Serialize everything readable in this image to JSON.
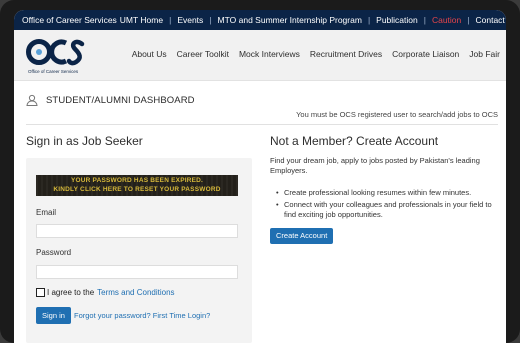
{
  "topbar": {
    "org": "Office of Career Services",
    "links": [
      "UMT Home",
      "Events",
      "MTO and Summer Internship Program",
      "Publication",
      "Caution",
      "Contact Us"
    ]
  },
  "header": {
    "logo_text": "OCS",
    "logo_caption": "Office of Career Services",
    "nav": [
      "About Us",
      "Career Toolkit",
      "Mock Interviews",
      "Recruitment Drives",
      "Corporate Liaison",
      "Job Fair"
    ]
  },
  "dashboard": {
    "title": "STUDENT/ALUMNI DASHBOARD",
    "note": "You must be OCS registered user to search/add jobs to OCS"
  },
  "signin": {
    "title": "Sign in as Job Seeker",
    "expired_line1": "YOUR PASSWORD HAS BEEN EXPIRED.",
    "expired_line2": "KINDLY CLICK HERE TO RESET YOUR PASSWORD",
    "email_label": "Email",
    "password_label": "Password",
    "agree_prefix": "I agree to the",
    "agree_link": "Terms and Conditions",
    "signin_label": "Sign in",
    "forgot_link": "Forgot your password? First Time Login?"
  },
  "not_member": {
    "title": "Not a Member? Create Account",
    "description": "Find your dream job, apply to jobs posted by Pakistan's leading Employers.",
    "bullets": [
      "Create professional looking resumes within few minutes.",
      "Connect with your colleagues and professionals in your field to find exciting job opportunities."
    ],
    "create_label": "Create Account"
  },
  "colors": {
    "topbar": "#0b2447",
    "accent": "#1f6fb2",
    "caution": "#e5454a",
    "banner_text": "#d6b83a"
  }
}
